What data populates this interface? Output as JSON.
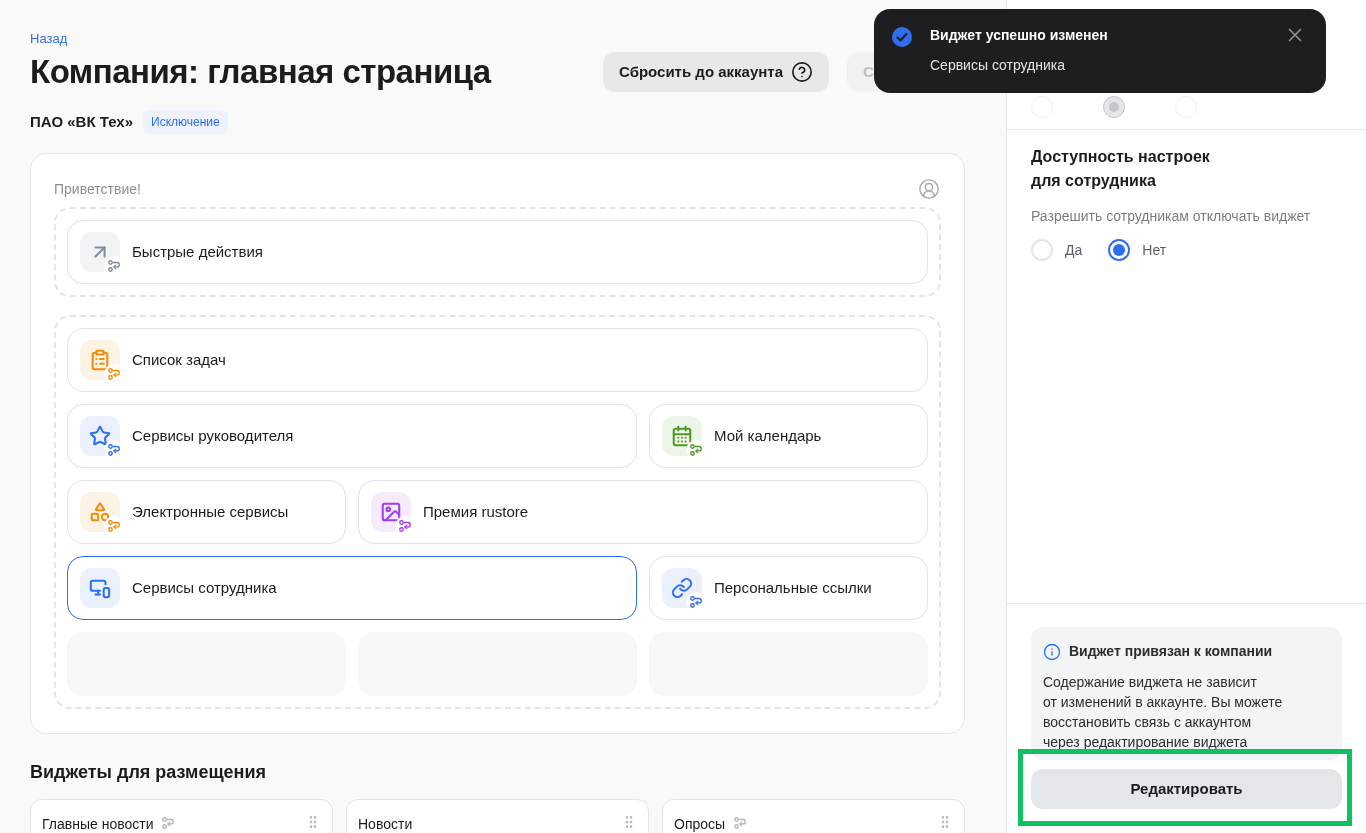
{
  "back_link": "Назад",
  "title": "Компания: главная страница",
  "header_buttons": [
    {
      "label": "Сбросить до аккаунта",
      "kind": "help"
    },
    {
      "label": "С",
      "kind": "plain"
    }
  ],
  "organization": {
    "name": "ПАО «ВК Тех»",
    "badge": "Исключение"
  },
  "layout": {
    "greeting": "Приветствие!",
    "groups": [
      {
        "items": [
          {
            "label": "Быстрые действия",
            "kind": "full",
            "color": "#818c99",
            "linked": true,
            "selected": false
          }
        ]
      },
      {
        "items": [
          {
            "label": "Список задач",
            "kind": "full",
            "color": "#f08c00",
            "linked": true,
            "selected": false
          },
          {
            "label": "Сервисы руководителя",
            "kind": "wide",
            "color": "#2d6ff0",
            "linked": true,
            "selected": false
          },
          {
            "label": "Мой календарь",
            "kind": "narrow",
            "color": "#4b9a22",
            "linked": true,
            "selected": false
          },
          {
            "label": "Электронные сервисы",
            "kind": "narrow",
            "color": "#f08c00",
            "linked": true,
            "selected": false
          },
          {
            "label": "Премия rustore",
            "kind": "wide",
            "color": "#a33bf0",
            "linked": true,
            "selected": false
          },
          {
            "label": "Сервисы сотрудника",
            "kind": "wide",
            "color": "#2d6ff0",
            "linked": false,
            "selected": true
          },
          {
            "label": "Персональные ссылки",
            "kind": "narrow",
            "color": "#2d6ff0",
            "linked": true,
            "selected": false
          },
          {
            "kind": "empty"
          },
          {
            "kind": "empty"
          },
          {
            "kind": "empty"
          }
        ]
      }
    ]
  },
  "available_widgets": {
    "title": "Виджеты для размещения",
    "items": [
      {
        "label": "Главные новости",
        "linked": true
      },
      {
        "label": "Новости",
        "linked": false
      },
      {
        "label": "Опросы",
        "linked": true
      }
    ]
  },
  "settings": {
    "sizes": [
      {
        "selected": false
      },
      {
        "selected": true
      },
      {
        "selected": false
      }
    ],
    "access_title": "Доступность настроек\nдля сотрудника",
    "access_question": "Разрешить сотрудникам отключать виджет",
    "access_options": [
      {
        "label": "Да",
        "selected": false
      },
      {
        "label": "Нет",
        "selected": true
      }
    ],
    "info": {
      "title": "Виджет привязан к компании",
      "text": "Содержание виджета не зависит\nот изменений в аккаунте. Вы можете\nвосстановить связь с аккаунтом\nчерез редактирование виджета"
    },
    "edit_button": {
      "label": "Редактировать",
      "highlighted": true
    }
  },
  "toast": {
    "title": "Виджет успешно изменен",
    "subtitle": "Сервисы сотрудника"
  }
}
